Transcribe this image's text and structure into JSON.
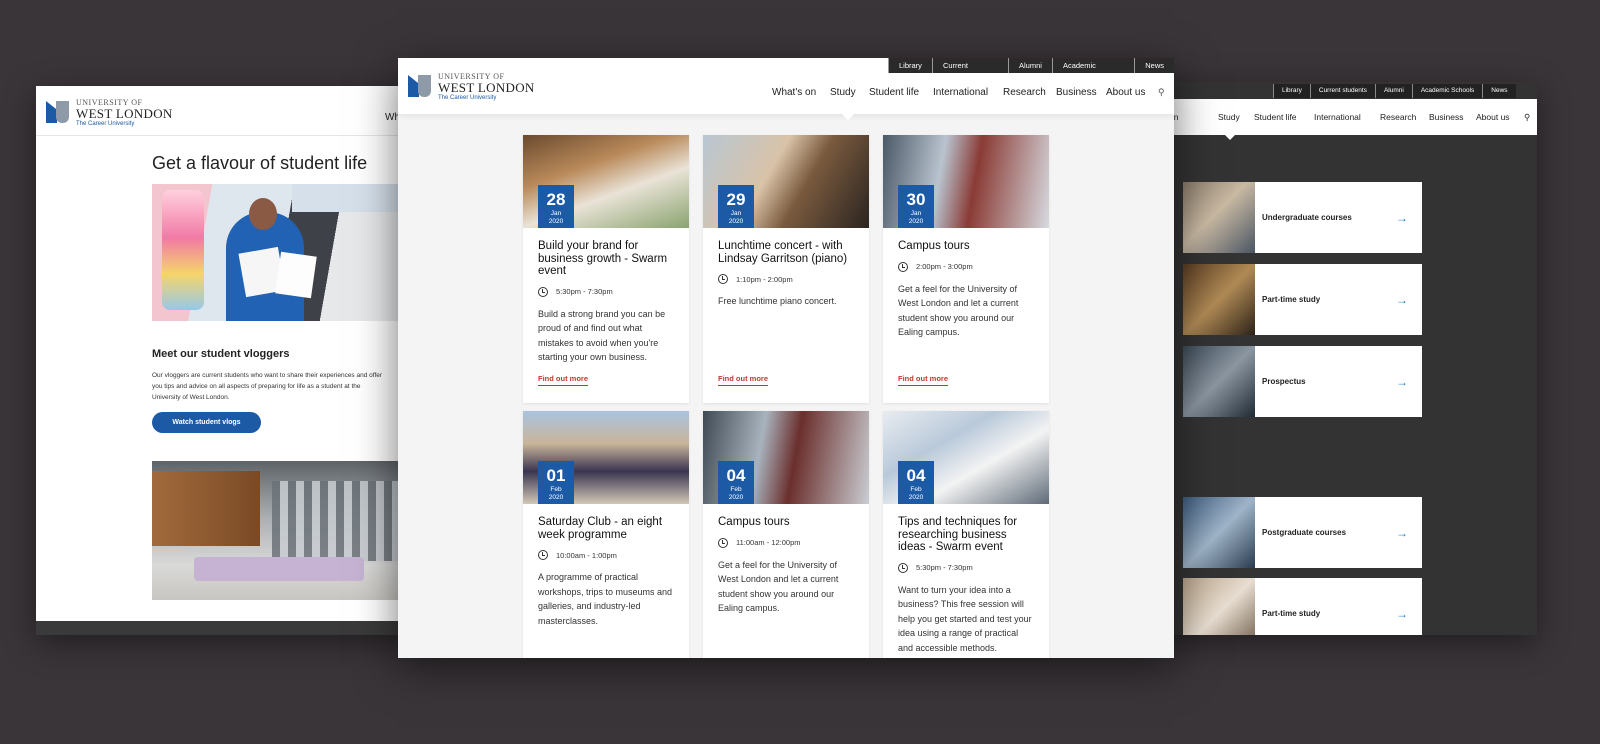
{
  "brand": {
    "line1": "UNIVERSITY OF",
    "line2": "WEST LONDON",
    "tagline": "The Career University",
    "accent": "#1d5aa6"
  },
  "left_page": {
    "nav_peek": "Wh",
    "heading": "Get a flavour of student life",
    "section_title": "Meet our student vloggers",
    "section_text": "Our vloggers are current students who want to share their experiences and offer you tips and advice on all aspects of preparing for life as a student at the University of West London.",
    "button_label": "Watch student vlogs"
  },
  "center_page": {
    "utility_links": [
      "Library",
      "Current students",
      "Alumni",
      "Academic Schools",
      "News"
    ],
    "main_nav": [
      "What's on",
      "Study",
      "Student life",
      "International",
      "Research",
      "Business",
      "About us"
    ],
    "search_icon": "search-icon",
    "events": [
      {
        "day": "28",
        "month": "Jan",
        "year": "2020",
        "title": "Build your brand for business growth - Swarm event",
        "time": "5:30pm - 7:30pm",
        "description": "Build a strong brand you can be proud of and find out what mistakes to avoid when you're starting your own business.",
        "link": "Find out more"
      },
      {
        "day": "29",
        "month": "Jan",
        "year": "2020",
        "title": "Lunchtime concert - with Lindsay Garritson (piano)",
        "time": "1:10pm - 2:00pm",
        "description": "Free lunchtime piano concert.",
        "link": "Find out more"
      },
      {
        "day": "30",
        "month": "Jan",
        "year": "2020",
        "title": "Campus tours",
        "time": "2:00pm - 3:00pm",
        "description": "Get a feel for the University of West London and let a current student show you around our Ealing campus.",
        "link": "Find out more"
      },
      {
        "day": "01",
        "month": "Feb",
        "year": "2020",
        "title": "Saturday Club - an eight week programme",
        "time": "10:00am - 1:00pm",
        "description": "A programme of practical workshops, trips to museums and galleries, and industry-led masterclasses.",
        "link": ""
      },
      {
        "day": "04",
        "month": "Feb",
        "year": "2020",
        "title": "Campus tours",
        "time": "11:00am - 12:00pm",
        "description": "Get a feel for the University of West London and let a current student show you around our Ealing campus.",
        "link": ""
      },
      {
        "day": "04",
        "month": "Feb",
        "year": "2020",
        "title": "Tips and techniques for researching business ideas - Swarm event",
        "time": "5:30pm - 7:30pm",
        "description": "Want to turn your idea into a business? This free session will help you get started and test your idea using a range of practical and accessible methods.",
        "link": ""
      }
    ]
  },
  "right_page": {
    "utility_links": [
      "Library",
      "Current students",
      "Alumni",
      "Academic Schools",
      "News"
    ],
    "main_nav": [
      "What's on",
      "Study",
      "Student life",
      "International",
      "Research",
      "Business",
      "About us"
    ],
    "cards": [
      {
        "label": "Undergraduate courses"
      },
      {
        "label": "Part-time study"
      },
      {
        "label": "Prospectus"
      },
      {
        "label": "Postgraduate courses"
      },
      {
        "label": "Part-time study"
      }
    ],
    "arrow_icon": "arrow-right-icon"
  }
}
